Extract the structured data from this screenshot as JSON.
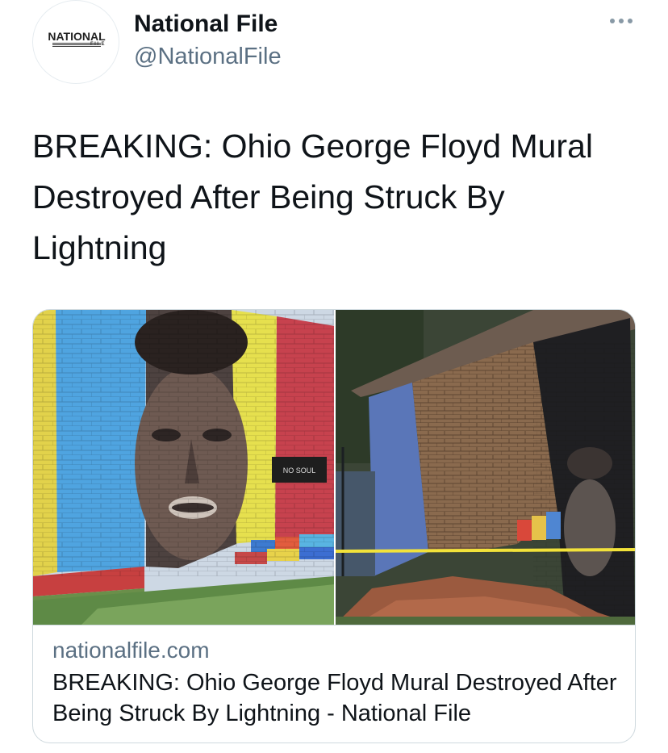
{
  "account": {
    "name": "National File",
    "handle": "@NationalFile",
    "avatar_logo_main": "NATIONAL",
    "avatar_logo_sub": "FILE"
  },
  "tweet": {
    "text": "BREAKING: Ohio George Floyd Mural\nDestroyed After Being Struck By\nLightning"
  },
  "card": {
    "domain": "nationalfile.com",
    "title": "BREAKING: Ohio George Floyd Mural Destroyed After Being Struck By Lightning - National File",
    "mural_sign_text": "NO SOUL"
  },
  "icons": {
    "more": "more-horizontal-icon"
  },
  "colors": {
    "text_primary": "#0f1419",
    "text_secondary": "#5b7083",
    "border": "#cfd9de",
    "caution_tape": "#f2e23a"
  }
}
